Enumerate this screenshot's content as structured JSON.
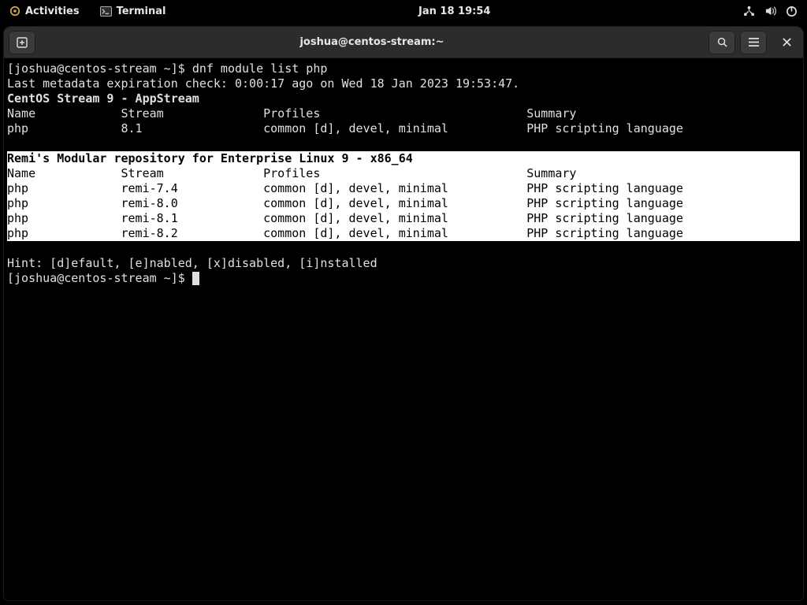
{
  "topbar": {
    "activities": "Activities",
    "app": "Terminal",
    "clock": "Jan 18  19:54"
  },
  "window": {
    "title": "joshua@centos-stream:~"
  },
  "term": {
    "prompt": "[joshua@centos-stream ~]$ ",
    "cmd": "dnf module list php",
    "meta": "Last metadata expiration check: 0:00:17 ago on Wed 18 Jan 2023 19:53:47.",
    "repo1_header": "CentOS Stream 9 - AppStream",
    "cols": "Name            Stream              Profiles                             Summary",
    "r1": "php             8.1                 common [d], devel, minimal           PHP scripting language",
    "blank": "",
    "repo2_header": "Remi's Modular repository for Enterprise Linux 9 - x86_64",
    "cols2": "Name            Stream              Profiles                             Summary",
    "remi1": "php             remi-7.4            common [d], devel, minimal           PHP scripting language      ",
    "remi2": "php             remi-8.0            common [d], devel, minimal           PHP scripting language      ",
    "remi3": "php             remi-8.1            common [d], devel, minimal           PHP scripting language      ",
    "remi4": "php             remi-8.2            common [d], devel, minimal           PHP scripting language      ",
    "hint": "Hint: [d]efault, [e]nabled, [x]disabled, [i]nstalled",
    "prompt2": "[joshua@centos-stream ~]$ "
  }
}
